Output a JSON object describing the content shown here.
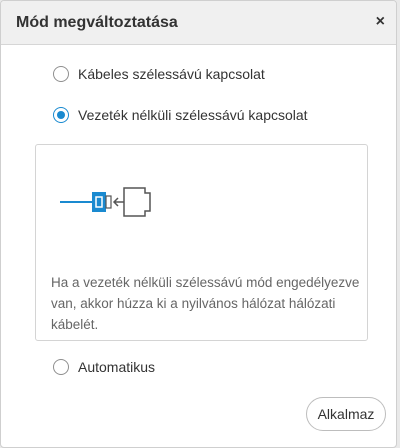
{
  "dialog": {
    "title": "Mód megváltoztatása",
    "close_glyph": "×"
  },
  "options": [
    {
      "label": "Kábeles szélessávú kapcsolat",
      "selected": false
    },
    {
      "label": "Vezeték nélküli szélessávú kapcsolat",
      "selected": true
    },
    {
      "label": "Automatikus",
      "selected": false
    }
  ],
  "info": {
    "illustration_icon": "unplug-ethernet-cable-icon",
    "text": "Ha a vezeték nélküli szélessávú mód engedélyezve van, akkor húzza ki a nyilvános hálózat hálózati kábelét."
  },
  "actions": {
    "apply_label": "Alkalmaz"
  },
  "colors": {
    "accent": "#1a8ad0",
    "header_bg": "#f0f0f0"
  }
}
